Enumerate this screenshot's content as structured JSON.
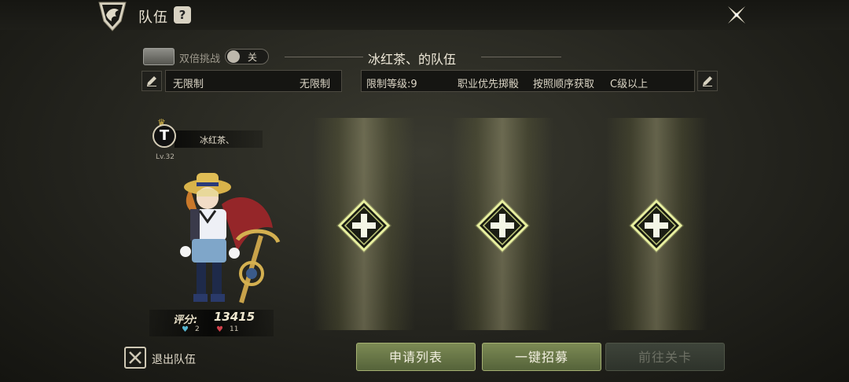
{
  "header": {
    "title": "队伍",
    "help_icon": "question-icon",
    "close_icon": "close-icon"
  },
  "options": {
    "double_label": "双倍挑战",
    "toggle_state": "关",
    "team_title": "冰红茶、的队伍"
  },
  "filters": {
    "left_value": "无限制",
    "left_value_right": "无限制",
    "level_limit": "限制等级:9",
    "class_priority": "职业优先掷骰",
    "loot_rule": "按照顺序获取",
    "grade": "C级以上"
  },
  "player": {
    "name": "冰红茶、",
    "level": "Lv.32",
    "avatar_letter": "T",
    "score_label": "评分:",
    "score": "13415",
    "stat_a": "2",
    "stat_b": "11"
  },
  "slots": [
    {
      "icon": "plus-icon"
    },
    {
      "icon": "plus-icon"
    },
    {
      "icon": "plus-icon"
    }
  ],
  "footer": {
    "exit_label": "退出队伍",
    "apply_list": "申请列表",
    "recruit": "一键招募",
    "go_stage": "前往关卡"
  },
  "colors": {
    "button_active": "#6b7a48",
    "button_disabled": "#353b32",
    "slot_glow": "#d8e08a"
  }
}
